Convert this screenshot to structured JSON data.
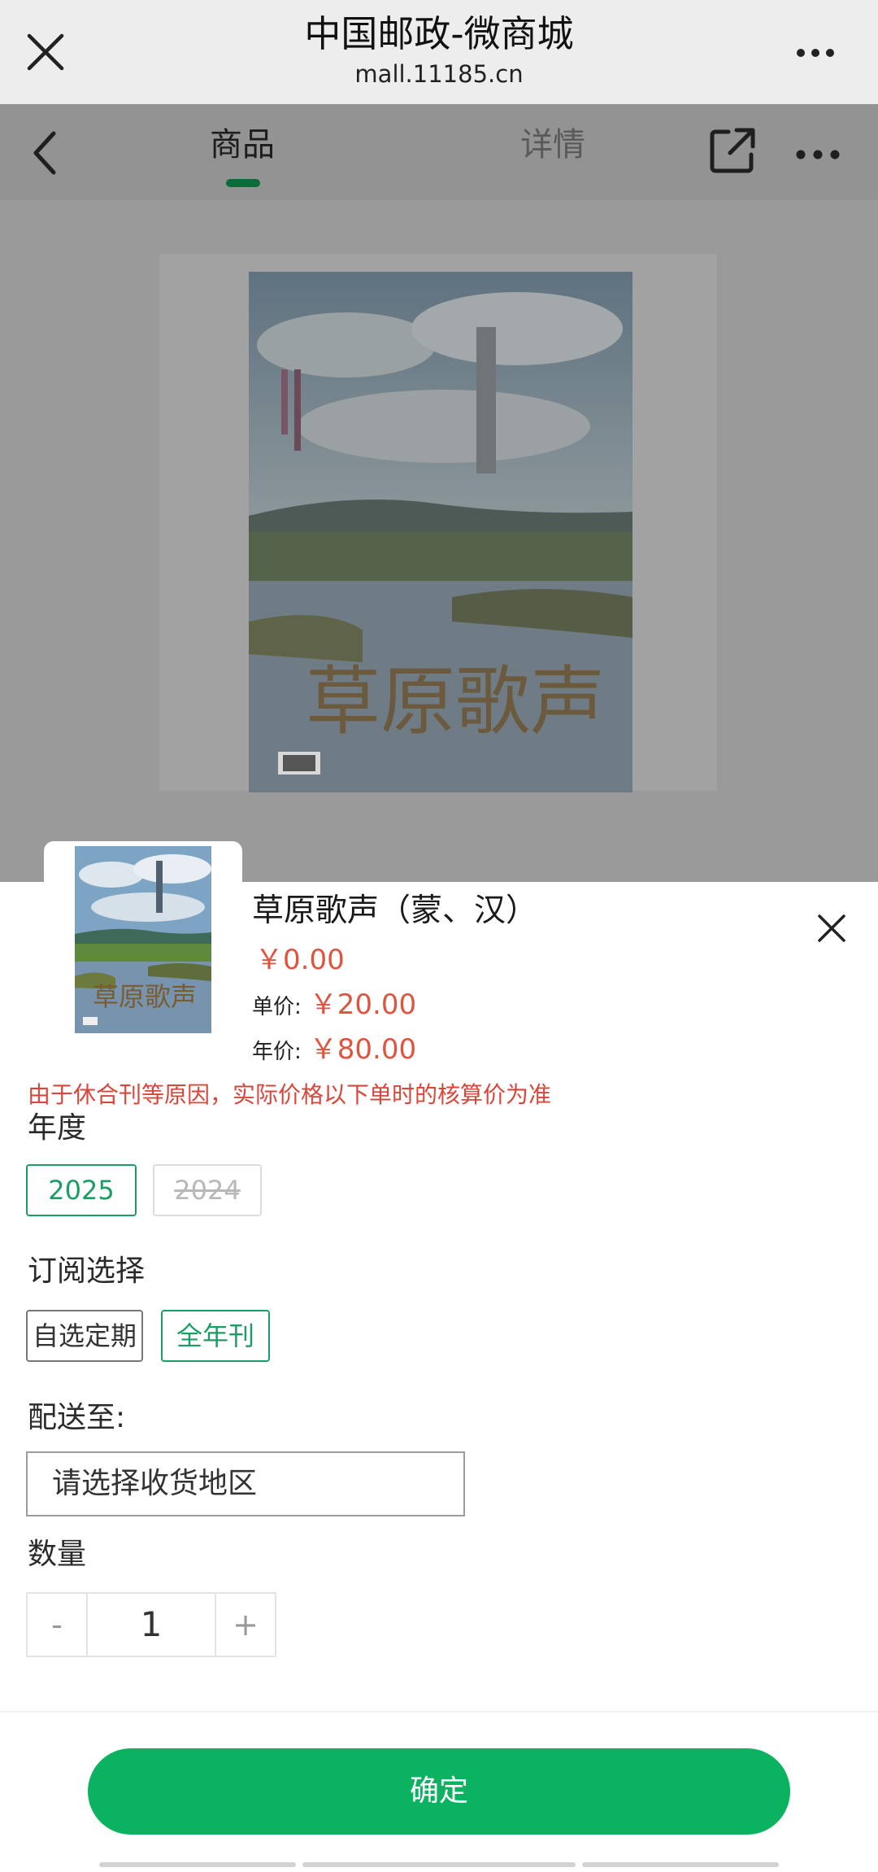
{
  "browser": {
    "title": "中国邮政-微商城",
    "url": "mall.11185.cn"
  },
  "nav": {
    "tabs": [
      {
        "label": "商品",
        "active": true
      },
      {
        "label": "详情",
        "active": false
      }
    ]
  },
  "product": {
    "name": "草原歌声（蒙、汉）",
    "price": "￥0.00",
    "unit_price_label": "单价:",
    "unit_price": "￥20.00",
    "year_price_label": "年价:",
    "year_price": "￥80.00",
    "notice": "由于休合刊等原因，实际价格以下单时的核算价为准"
  },
  "options": {
    "year_label": "年度",
    "years": [
      {
        "label": "2025",
        "state": "selected"
      },
      {
        "label": "2024",
        "state": "disabled"
      }
    ],
    "subscription_label": "订阅选择",
    "subscriptions": [
      {
        "label": "自选定期",
        "state": "normal"
      },
      {
        "label": "全年刊",
        "state": "selected"
      }
    ],
    "shipping_label": "配送至:",
    "shipping_placeholder": "请选择收货地区",
    "quantity_label": "数量",
    "quantity": "1",
    "minus": "-",
    "plus": "+"
  },
  "actions": {
    "confirm": "确定"
  },
  "colors": {
    "accent_green": "#1e9c66",
    "confirm_green": "#0bb260",
    "price_red": "#e0533e"
  }
}
